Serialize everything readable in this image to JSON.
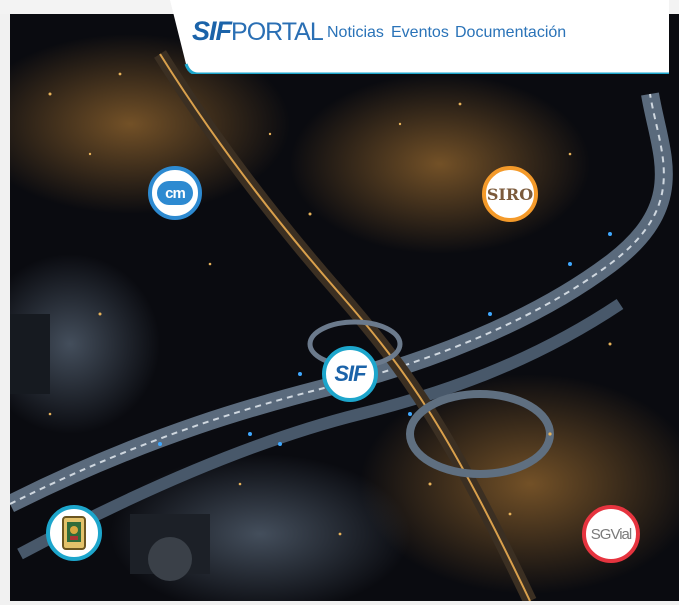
{
  "brand": {
    "logo_sif": "SIF",
    "logo_portal": "PORTAL",
    "accent": "#1b63a9"
  },
  "nav": {
    "items": [
      {
        "label": "Noticias"
      },
      {
        "label": "Eventos"
      },
      {
        "label": "Documentación"
      }
    ]
  },
  "apps": {
    "cm": {
      "label": "cm",
      "color": "#2d8ad1"
    },
    "siro": {
      "label": "SIRO",
      "color": "#f49a2a"
    },
    "sif": {
      "label": "SIF",
      "color": "#1da6cc"
    },
    "seal": {
      "icon": "city-seal-icon",
      "color": "#1da6cc"
    },
    "sgvial": {
      "label": "SGVial",
      "color": "#e6343f"
    }
  }
}
